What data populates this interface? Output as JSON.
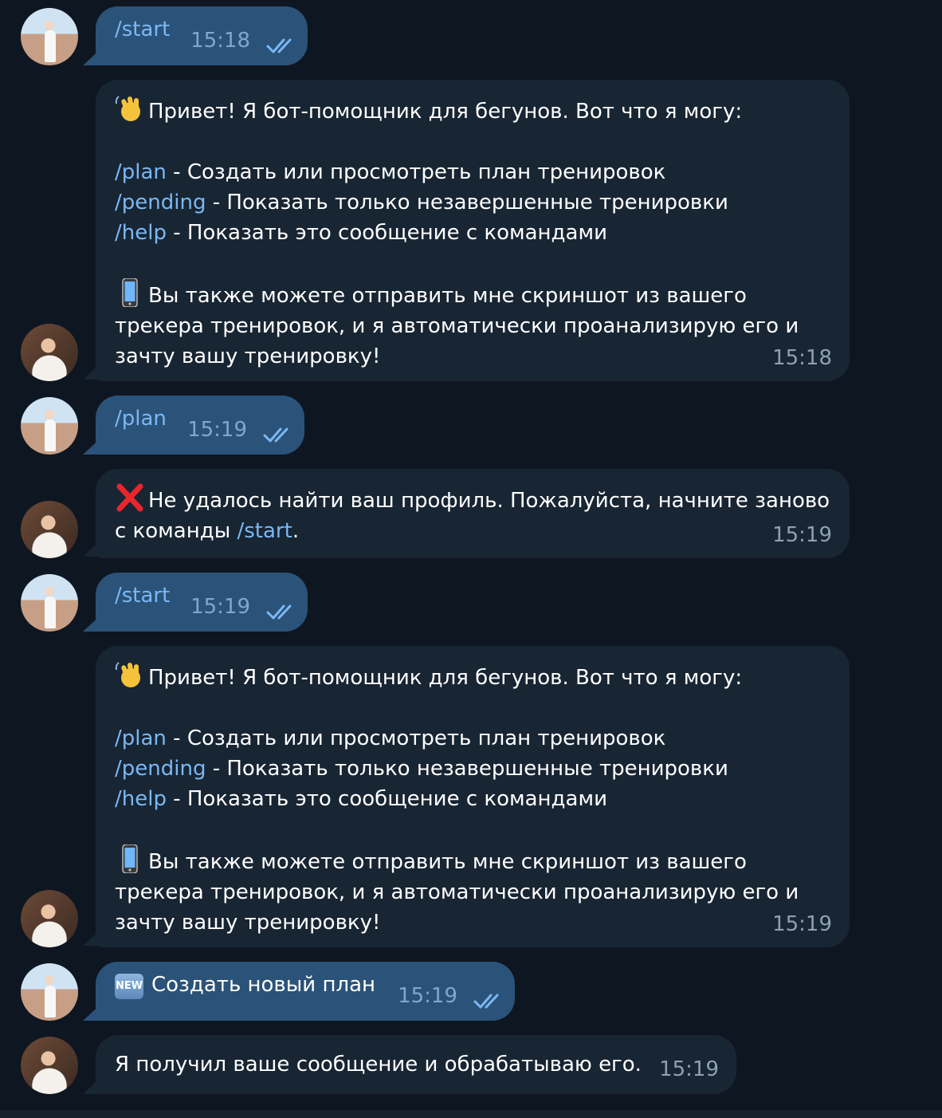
{
  "messages": [
    {
      "type": "out",
      "cmd": "/start",
      "time": "15:18"
    },
    {
      "type": "in",
      "greeting": "Привет! Я бот-помощник для бегунов. Вот что я могу:",
      "commands": [
        {
          "cmd": "/plan",
          "desc": " - Создать или просмотреть план тренировок"
        },
        {
          "cmd": "/pending",
          "desc": " - Показать только незавершенные тренировки"
        },
        {
          "cmd": "/help",
          "desc": " - Показать это сообщение с командами"
        }
      ],
      "note_lines": [
        "Вы также можете отправить мне скриншот из вашего",
        "трекера тренировок, и я автоматически проанализирую его и",
        "зачту вашу тренировку!"
      ],
      "time": "15:18"
    },
    {
      "type": "out",
      "cmd": "/plan",
      "time": "15:19"
    },
    {
      "type": "in-error",
      "line1": "Не удалось найти ваш профиль. Пожалуйста, начните заново",
      "line2_prefix": "с команды ",
      "line2_cmd": "/start",
      "line2_suffix": ".",
      "time": "15:19"
    },
    {
      "type": "out",
      "cmd": "/start",
      "time": "15:19"
    },
    {
      "type": "in",
      "greeting": "Привет! Я бот-помощник для бегунов. Вот что я могу:",
      "commands": [
        {
          "cmd": "/plan",
          "desc": " - Создать или просмотреть план тренировок"
        },
        {
          "cmd": "/pending",
          "desc": " - Показать только незавершенные тренировки"
        },
        {
          "cmd": "/help",
          "desc": " - Показать это сообщение с командами"
        }
      ],
      "note_lines": [
        "Вы также можете отправить мне скриншот из вашего",
        "трекера тренировок, и я автоматически проанализирую его и",
        "зачту вашу тренировку!"
      ],
      "time": "15:19"
    },
    {
      "type": "out-new",
      "badge": "NEW",
      "text": "Создать новый план",
      "time": "15:19"
    },
    {
      "type": "in-plain",
      "text": "Я получил ваше сообщение и обрабатываю его.",
      "time": "15:19"
    }
  ],
  "colors": {
    "background": "#0e1621",
    "outgoing": "#2b5278",
    "incoming": "#182533",
    "command": "#7ab8f5"
  },
  "icons": {
    "wave": "waving-hand-emoji",
    "phone": "mobile-phone-emoji",
    "cross": "cross-mark-emoji",
    "check": "double-check-icon"
  }
}
